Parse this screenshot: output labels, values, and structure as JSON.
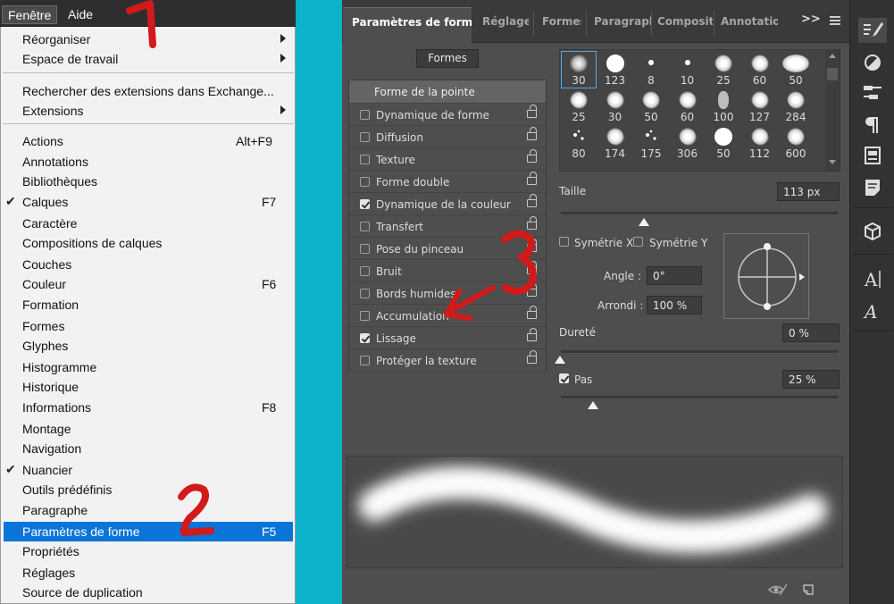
{
  "menubar": {
    "fenetre": "Fenêtre",
    "aide": "Aide"
  },
  "menu": {
    "items": [
      {
        "label": "Réorganiser",
        "submenu": true
      },
      {
        "label": "Espace de travail",
        "submenu": true
      },
      {
        "label": "Rechercher des extensions dans Exchange..."
      },
      {
        "label": "Extensions",
        "submenu": true
      },
      {
        "label": "Actions",
        "shortcut": "Alt+F9"
      },
      {
        "label": "Annotations"
      },
      {
        "label": "Bibliothèques"
      },
      {
        "label": "Calques",
        "shortcut": "F7",
        "checked": true
      },
      {
        "label": "Caractère"
      },
      {
        "label": "Compositions de calques"
      },
      {
        "label": "Couches"
      },
      {
        "label": "Couleur",
        "shortcut": "F6"
      },
      {
        "label": "Formation"
      },
      {
        "label": "Formes"
      },
      {
        "label": "Glyphes"
      },
      {
        "label": "Histogramme"
      },
      {
        "label": "Historique"
      },
      {
        "label": "Informations",
        "shortcut": "F8"
      },
      {
        "label": "Montage"
      },
      {
        "label": "Navigation"
      },
      {
        "label": "Nuancier",
        "checked": true
      },
      {
        "label": "Outils prédéfinis"
      },
      {
        "label": "Paragraphe"
      },
      {
        "label": "Paramètres de forme",
        "shortcut": "F5",
        "highlighted": true
      },
      {
        "label": "Propriétés"
      },
      {
        "label": "Réglages"
      },
      {
        "label": "Source de duplication"
      }
    ]
  },
  "panel": {
    "tabs": [
      "Paramètres de forme",
      "Réglages",
      "Formes",
      "Paragraphe",
      "Compositio",
      "Annotation"
    ],
    "overflow": ">>",
    "formes_button": "Formes",
    "options_header": "Forme de la pointe",
    "options": [
      {
        "label": "Dynamique de forme",
        "checked": false
      },
      {
        "label": "Diffusion",
        "checked": false
      },
      {
        "label": "Texture",
        "checked": false
      },
      {
        "label": "Forme double",
        "checked": false
      },
      {
        "label": "Dynamique de la couleur",
        "checked": true
      },
      {
        "label": "Transfert",
        "checked": false
      },
      {
        "label": "Pose du pinceau",
        "checked": false
      },
      {
        "label": "Bruit",
        "checked": false
      },
      {
        "label": "Bords humides",
        "checked": false
      },
      {
        "label": "Accumulation",
        "checked": false
      },
      {
        "label": "Lissage",
        "checked": true
      },
      {
        "label": "Protéger la texture",
        "checked": false
      }
    ],
    "brush_sizes": [
      "30",
      "123",
      "8",
      "10",
      "25",
      "60",
      "50",
      "25",
      "30",
      "50",
      "60",
      "100",
      "127",
      "284",
      "80",
      "174",
      "175",
      "306",
      "50",
      "112",
      "600"
    ],
    "size_label": "Taille",
    "size_value": "113 px",
    "size_fraction": 0.3,
    "flip_x": "Symétrie X",
    "flip_y": "Symétrie Y",
    "angle_label": "Angle :",
    "angle_value": "0°",
    "roundness_label": "Arrondi :",
    "roundness_value": "100 %",
    "hardness_label": "Dureté",
    "hardness_value": "0 %",
    "spacing_label": "Pas",
    "spacing_value": "25 %",
    "spacing_checked": true
  },
  "annotations": [
    "1",
    "2",
    "3"
  ],
  "colors": {
    "highlight": "#0a74d9",
    "teal": "#0cb2c9",
    "annotation": "#d21a1a"
  }
}
